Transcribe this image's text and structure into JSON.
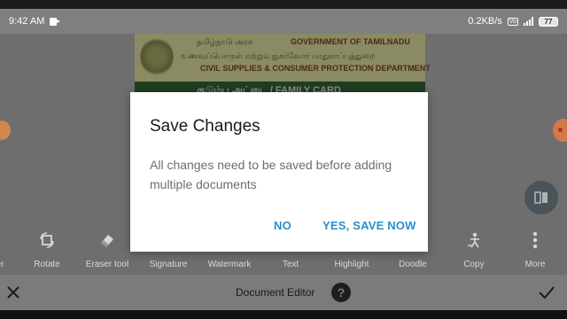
{
  "status_bar": {
    "time": "9:42 AM",
    "network_speed": "0.2KB/s",
    "vo_label": "Vo",
    "battery": "77"
  },
  "document": {
    "tamil_state": "தமிழ்நாடு அரசு",
    "gov_title": "GOVERNMENT OF TAMILNADU",
    "tamil_dept": "உணவுப்பொருள் மற்றும் நுகர்வோர் பாதுகாப்புத்துறை",
    "dept_title": "CIVIL SUPPLIES & CONSUMER PROTECTION DEPARTMENT",
    "card_title": "குடும்ப அட்டை / FAMILY CARD"
  },
  "toolbar": {
    "items": [
      {
        "label": "er",
        "icon": "eraser-partial-icon"
      },
      {
        "label": "Rotate",
        "icon": "rotate-icon"
      },
      {
        "label": "Eraser tool",
        "icon": "eraser-icon"
      },
      {
        "label": "Signature",
        "icon": "signature-icon"
      },
      {
        "label": "Watermark",
        "icon": "watermark-icon"
      },
      {
        "label": "Text",
        "icon": "text-icon"
      },
      {
        "label": "Highlight",
        "icon": "highlight-icon"
      },
      {
        "label": "Doodle",
        "icon": "doodle-icon"
      },
      {
        "label": "Copy",
        "icon": "copy-icon"
      },
      {
        "label": "More",
        "icon": "more-vertical-icon"
      }
    ]
  },
  "bottom_bar": {
    "title": "Document Editor",
    "help_glyph": "?"
  },
  "dialog": {
    "title": "Save Changes",
    "message": "All changes need to be saved before adding multiple documents",
    "no_label": "NO",
    "yes_label": "YES, SAVE NOW"
  },
  "colors": {
    "accent": "#2a8ecf",
    "dialog_bg": "#ffffff",
    "dimmed_bg": "#6e6e6e"
  }
}
